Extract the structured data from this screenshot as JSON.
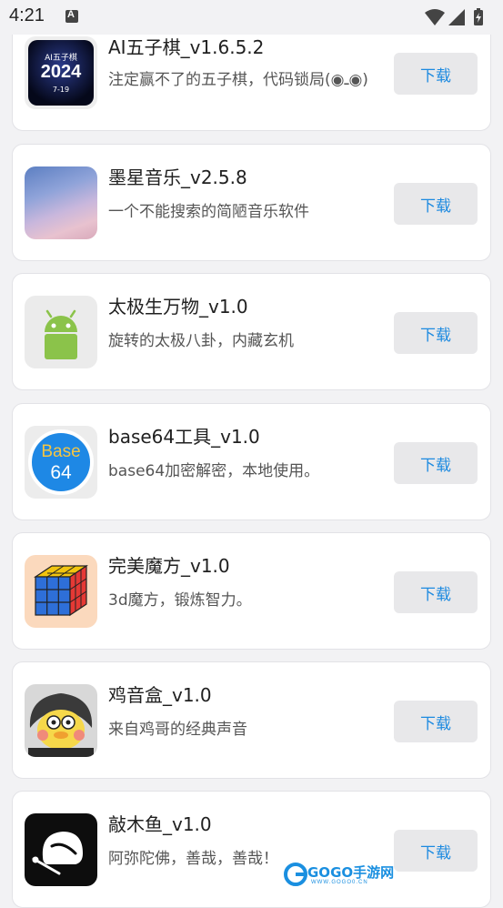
{
  "status_bar": {
    "time": "4:21"
  },
  "apps": [
    {
      "title": "AI五子棋_v1.6.5.2",
      "desc": "注定赢不了的五子棋，代码锁局(◉ـ◉)",
      "button": "下载",
      "icon": "gomoku-2024-icon",
      "icon_text": [
        "AI五子棋",
        "2024",
        "7-19"
      ]
    },
    {
      "title": "墨星音乐_v2.5.8",
      "desc": "一个不能搜索的简陋音乐软件",
      "button": "下载",
      "icon": "sky-clouds-icon"
    },
    {
      "title": "太极生万物_v1.0",
      "desc": "旋转的太极八卦，内藏玄机",
      "button": "下载",
      "icon": "android-robot-icon"
    },
    {
      "title": "base64工具_v1.0",
      "desc": "base64加密解密，本地使用。",
      "button": "下载",
      "icon": "base64-badge-icon",
      "icon_text": [
        "Base",
        "64"
      ]
    },
    {
      "title": "完美魔方_v1.0",
      "desc": "3d魔方，锻炼智力。",
      "button": "下载",
      "icon": "rubiks-cube-icon"
    },
    {
      "title": "鸡音盒_v1.0",
      "desc": "来自鸡哥的经典声音",
      "button": "下载",
      "icon": "cartoon-duck-icon"
    },
    {
      "title": "敲木鱼_v1.0",
      "desc": "阿弥陀佛，善哉，善哉！",
      "button": "下载",
      "icon": "wooden-fish-icon"
    }
  ],
  "watermark": {
    "brand": "GOGO手游网",
    "url": "WWW.GOGO0.CN"
  }
}
